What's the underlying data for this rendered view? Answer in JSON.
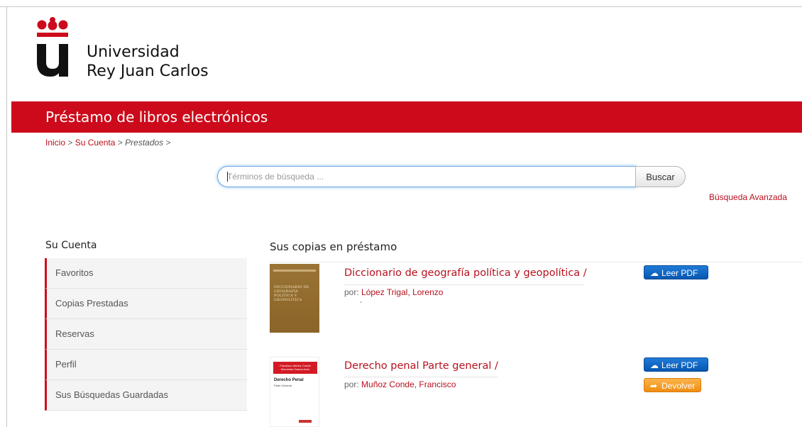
{
  "header": {
    "university_line1": "Universidad",
    "university_line2": "Rey Juan Carlos",
    "brand_color": "#cc0a1b"
  },
  "banner": {
    "title": "Préstamo de libros electrónicos"
  },
  "breadcrumb": {
    "home": "Inicio",
    "account": "Su Cuenta",
    "current": "Prestados",
    "separator": ">"
  },
  "search": {
    "placeholder": "Términos de búsqueda ...",
    "button_label": "Buscar",
    "advanced_link": "Búsqueda Avanzada"
  },
  "sidebar": {
    "title": "Su Cuenta",
    "items": [
      {
        "label": "Favoritos"
      },
      {
        "label": "Copias Prestadas"
      },
      {
        "label": "Reservas"
      },
      {
        "label": "Perfil"
      },
      {
        "label": "Sus Búsquedas Guardadas"
      }
    ]
  },
  "main": {
    "title": "Sus copias en préstamo",
    "books": [
      {
        "title": "Diccionario de geografía política y geopolítica /",
        "by_prefix": "por:",
        "author": "López Trigal, Lorenzo",
        "extra": "-",
        "read_label": "Leer PDF",
        "cover_lines": "DICCIONARIO DE GEOGRAFÍA POLÍTICA Y GEOPOLÍTICA"
      },
      {
        "title": "Derecho penal Parte general /",
        "by_prefix": "por:",
        "author": "Muñoz Conde, Francisco",
        "read_label": "Leer PDF",
        "return_label": "Devolver",
        "cover_band": "Francisco Muñoz Conde Mercedes García Arán",
        "cover_title": "Derecho Penal",
        "cover_sub": "Parte General"
      }
    ]
  }
}
